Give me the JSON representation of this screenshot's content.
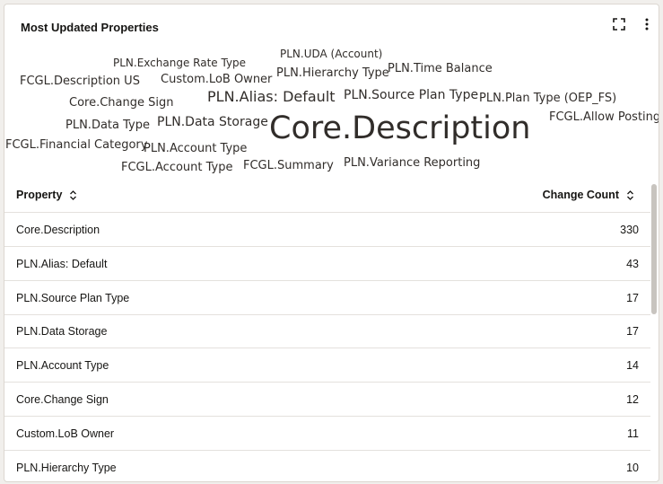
{
  "card": {
    "title": "Most Updated Properties",
    "expand_icon": "fullscreen-icon",
    "menu_icon": "kebab-menu-icon"
  },
  "word_cloud": {
    "words": [
      {
        "text": "PLN.UDA (Account)",
        "weight": 2
      },
      {
        "text": "PLN.Exchange Rate Type",
        "weight": 2
      },
      {
        "text": "FCGL.Description US",
        "weight": 3
      },
      {
        "text": "Custom.LoB Owner",
        "weight": 3
      },
      {
        "text": "PLN.Hierarchy Type",
        "weight": 3
      },
      {
        "text": "PLN.Time Balance",
        "weight": 3
      },
      {
        "text": "Core.Change Sign",
        "weight": 3
      },
      {
        "text": "PLN.Alias: Default",
        "weight": 5
      },
      {
        "text": "PLN.Source Plan Type",
        "weight": 4
      },
      {
        "text": "PLN.Plan Type (OEP_FS)",
        "weight": 3
      },
      {
        "text": "FCGL.Allow Posting",
        "weight": 3
      },
      {
        "text": "PLN.Data Type",
        "weight": 3
      },
      {
        "text": "PLN.Data Storage",
        "weight": 4
      },
      {
        "text": "Core.Description",
        "weight": 10
      },
      {
        "text": "FCGL.Financial Category",
        "weight": 3
      },
      {
        "text": "PLN.Account Type",
        "weight": 3
      },
      {
        "text": "FCGL.Account Type",
        "weight": 3
      },
      {
        "text": "FCGL.Summary",
        "weight": 3
      },
      {
        "text": "PLN.Variance Reporting",
        "weight": 3
      }
    ]
  },
  "table": {
    "columns": {
      "property": "Property",
      "change_count": "Change Count"
    },
    "sort_icon": "sort-updown-icon",
    "rows": [
      {
        "property": "Core.Description",
        "count": "330"
      },
      {
        "property": "PLN.Alias: Default",
        "count": "43"
      },
      {
        "property": "PLN.Source Plan Type",
        "count": "17"
      },
      {
        "property": "PLN.Data Storage",
        "count": "17"
      },
      {
        "property": "PLN.Account Type",
        "count": "14"
      },
      {
        "property": "Core.Change Sign",
        "count": "12"
      },
      {
        "property": "Custom.LoB Owner",
        "count": "11"
      },
      {
        "property": "PLN.Hierarchy Type",
        "count": "10"
      }
    ]
  },
  "colors": {
    "background": "#f1efec",
    "card": "#ffffff",
    "text": "#161513",
    "cloud_text": "#312d2a",
    "border": "#e4e1dd"
  }
}
